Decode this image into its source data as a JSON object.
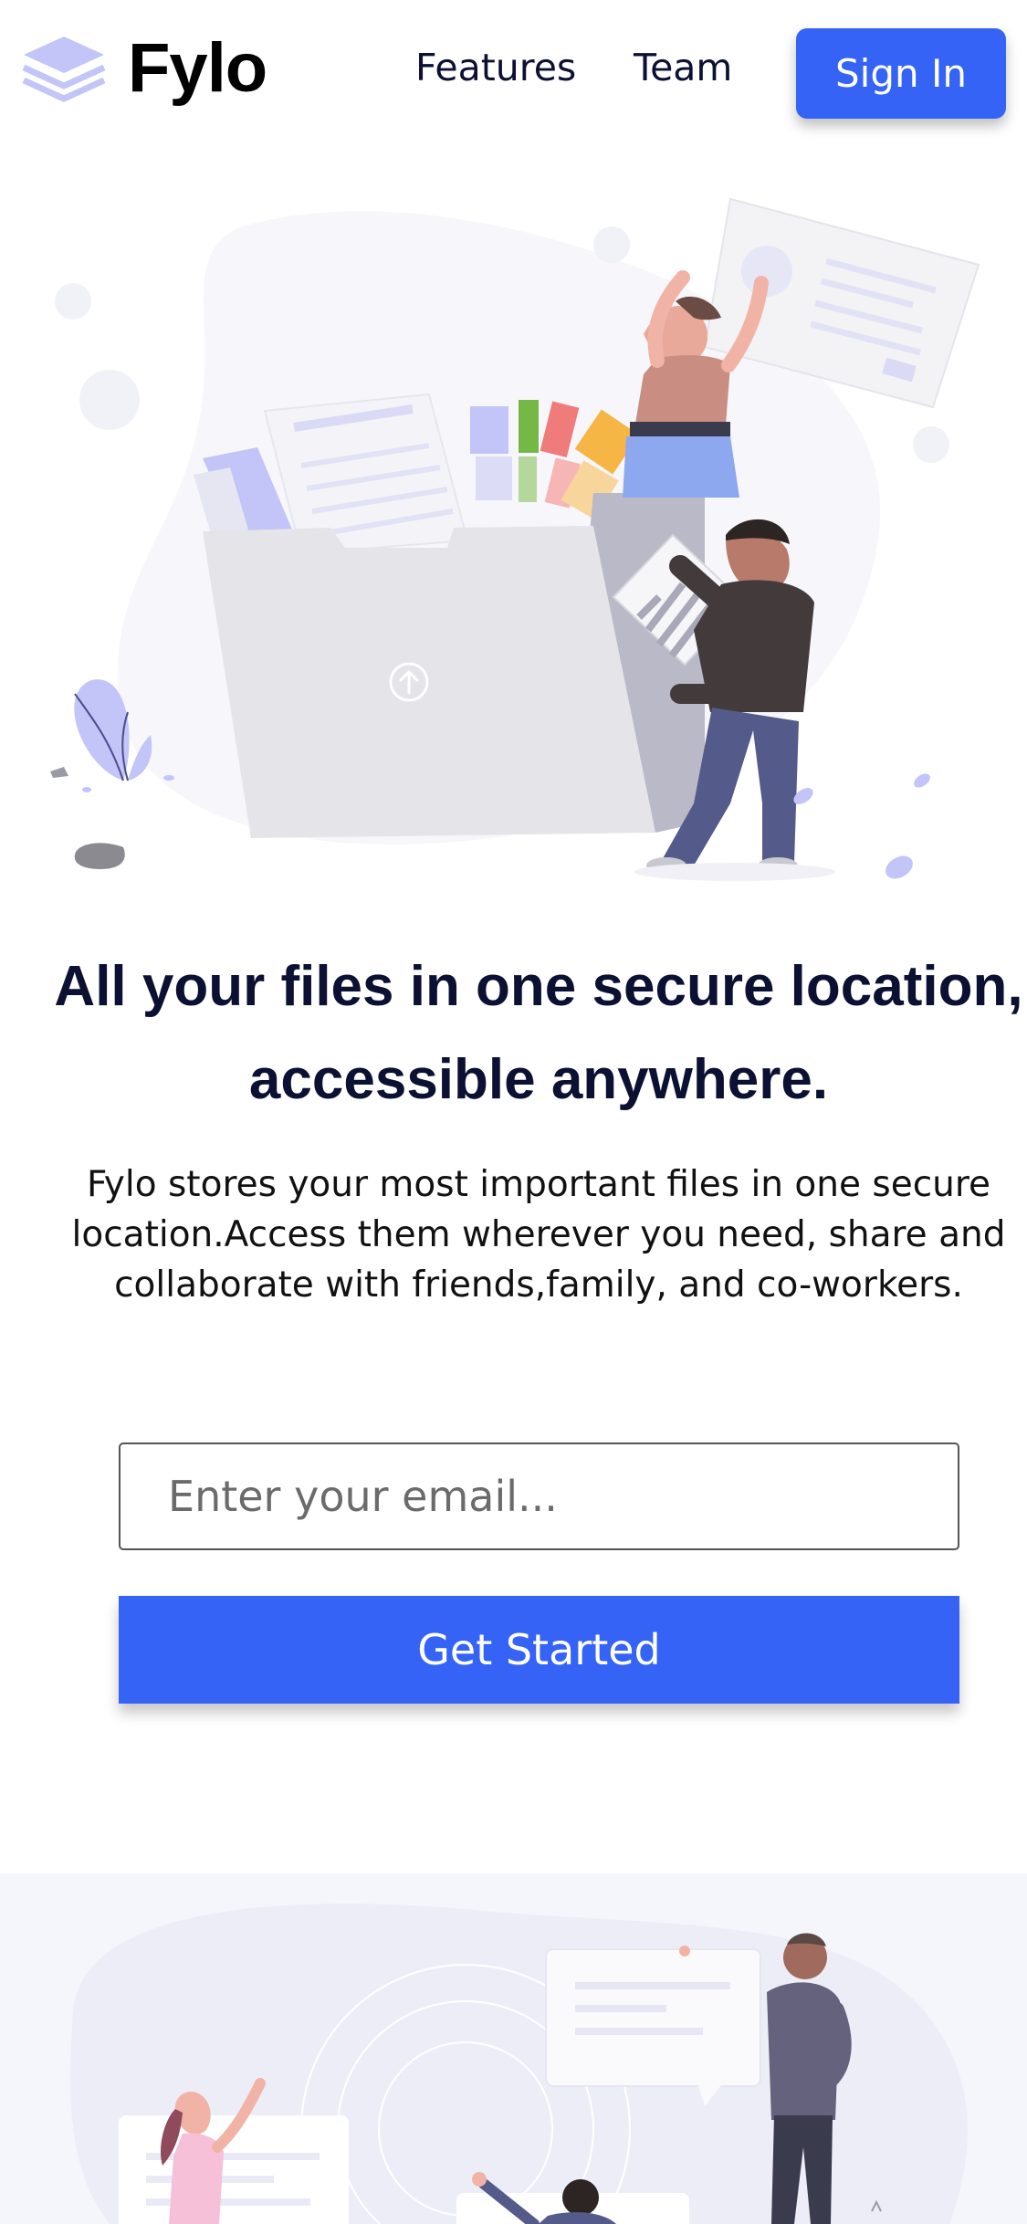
{
  "header": {
    "logo_text": "Fylo",
    "nav": [
      "Features",
      "Team"
    ],
    "signin_label": "Sign In"
  },
  "hero": {
    "title": "All your files in one secure location, accessible anywhere.",
    "description": "Fylo stores your most important files in one secure location.Access them wherever you need, share and collaborate with friends,family, and co-workers.",
    "email_placeholder": "Enter your email...",
    "cta_label": "Get Started"
  },
  "colors": {
    "accent": "#3563f5",
    "heading": "#0c1033",
    "logo_icon": "#c3c4f7",
    "section_bg": "#f5f6fb"
  },
  "icons": [
    "layers-logo-icon",
    "upload-arrow-icon"
  ]
}
